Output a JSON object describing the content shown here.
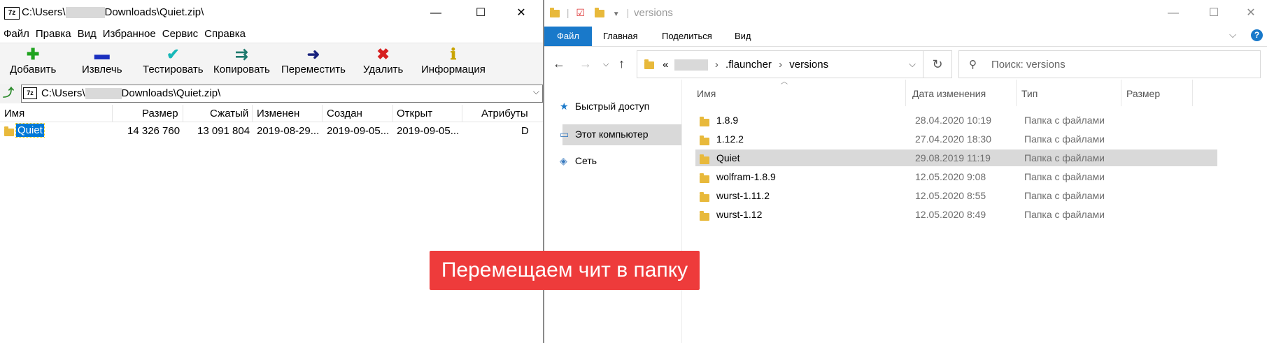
{
  "sevenzip": {
    "title_prefix": "C:\\Users\\",
    "title_suffix": "Downloads\\Quiet.zip\\",
    "logo": "7z",
    "window_controls": {
      "minimize": "—",
      "maximize": "☐",
      "close": "✕"
    },
    "menu": [
      "Файл",
      "Правка",
      "Вид",
      "Избранное",
      "Сервис",
      "Справка"
    ],
    "toolbar": [
      {
        "label": "Добавить",
        "icon": "plus-icon",
        "glyph": "✚",
        "color": "#1fa31f"
      },
      {
        "label": "Извлечь",
        "icon": "minus-icon",
        "glyph": "▬",
        "color": "#1a2fbf"
      },
      {
        "label": "Тестировать",
        "icon": "check-icon",
        "glyph": "✔",
        "color": "#17b8b8"
      },
      {
        "label": "Копировать",
        "icon": "copy-arrows-icon",
        "glyph": "⇉",
        "color": "#1f7a6e"
      },
      {
        "label": "Переместить",
        "icon": "arrow-right-icon",
        "glyph": "➜",
        "color": "#1a237e"
      },
      {
        "label": "Удалить",
        "icon": "delete-x-icon",
        "glyph": "✖",
        "color": "#d61f1f"
      },
      {
        "label": "Информация",
        "icon": "info-icon",
        "glyph": "ℹ",
        "color": "#c9a400"
      }
    ],
    "address_prefix": "C:\\Users\\",
    "address_suffix": "Downloads\\Quiet.zip\\",
    "columns": [
      "Имя",
      "Размер",
      "Сжатый",
      "Изменен",
      "Создан",
      "Открыт",
      "Атрибуты"
    ],
    "rows": [
      {
        "name": "Quiet",
        "size": "14 326 760",
        "packed": "13 091 804",
        "modified": "2019-08-29...",
        "created": "2019-09-05...",
        "accessed": "2019-09-05...",
        "attributes": "D"
      }
    ]
  },
  "explorer": {
    "title": "versions",
    "window_controls": {
      "minimize": "—",
      "maximize": "☐",
      "close": "✕"
    },
    "ribbon_tabs": [
      "Файл",
      "Главная",
      "Поделиться",
      "Вид"
    ],
    "help": "?",
    "address": {
      "prefix": "«",
      "seg1": ".flauncher",
      "seg2": "versions"
    },
    "search_placeholder": "Поиск: versions",
    "nav": [
      "Быстрый доступ",
      "Этот компьютер",
      "Сеть"
    ],
    "columns": [
      "Имя",
      "Дата изменения",
      "Тип",
      "Размер"
    ],
    "rows": [
      {
        "name": "1.8.9",
        "date": "28.04.2020 10:19",
        "type": "Папка с файлами"
      },
      {
        "name": "1.12.2",
        "date": "27.04.2020 18:30",
        "type": "Папка с файлами"
      },
      {
        "name": "Quiet",
        "date": "29.08.2019 11:19",
        "type": "Папка с файлами"
      },
      {
        "name": "wolfram-1.8.9",
        "date": "12.05.2020 9:08",
        "type": "Папка с файлами"
      },
      {
        "name": "wurst-1.11.2",
        "date": "12.05.2020 8:55",
        "type": "Папка с файлами"
      },
      {
        "name": "wurst-1.12",
        "date": "12.05.2020 8:49",
        "type": "Папка с файлами"
      }
    ],
    "selected_row": 2
  },
  "caption": "Перемещаем чит в папку",
  "colors": {
    "accent": "#0078d7",
    "ribbon_file": "#1979ca",
    "caption_bg": "#ee3b3b",
    "folder": "#e8b93b"
  }
}
